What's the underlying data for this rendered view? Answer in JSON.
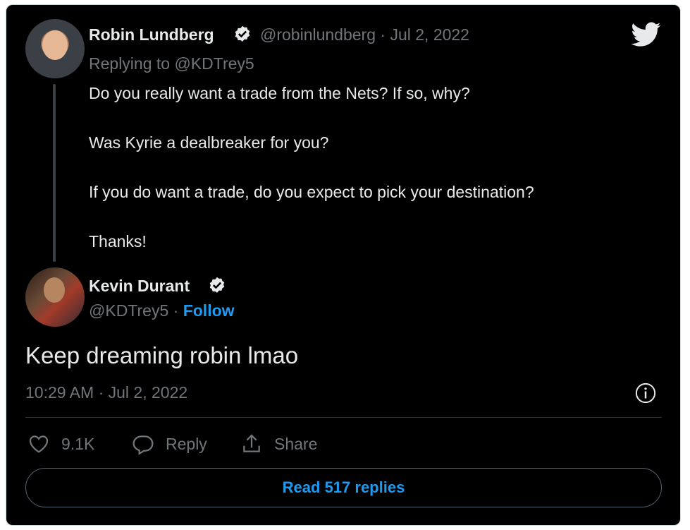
{
  "reply_tweet": {
    "author_name": "Robin Lundberg",
    "handle_date": "@robinlundberg · Jul 2, 2022",
    "replying_to": "Replying to @KDTrey5",
    "lines": [
      "Do you really want a trade from the Nets? If so, why?",
      "Was Kyrie a dealbreaker for you?",
      "If you do want a trade, do you expect to pick your destination?",
      "Thanks!"
    ]
  },
  "main_tweet": {
    "author_name": "Kevin Durant",
    "handle": "@KDTrey5",
    "separator": " · ",
    "follow_label": "Follow",
    "text": "Keep dreaming robin lmao",
    "timestamp": "10:29 AM · Jul 2, 2022"
  },
  "actions": {
    "likes_count": "9.1K",
    "reply_label": "Reply",
    "share_label": "Share"
  },
  "read_replies_label": "Read 517 replies",
  "icons": {
    "logo": "twitter-bird-icon",
    "verified": "verified-badge-icon",
    "info": "info-icon",
    "like": "heart-icon",
    "reply": "speech-bubble-icon",
    "share": "share-upload-icon"
  },
  "colors": {
    "background": "#000000",
    "text": "#e7e9ea",
    "muted": "#71767b",
    "accent": "#1d9bf0",
    "thread_line": "#3a3f44"
  }
}
